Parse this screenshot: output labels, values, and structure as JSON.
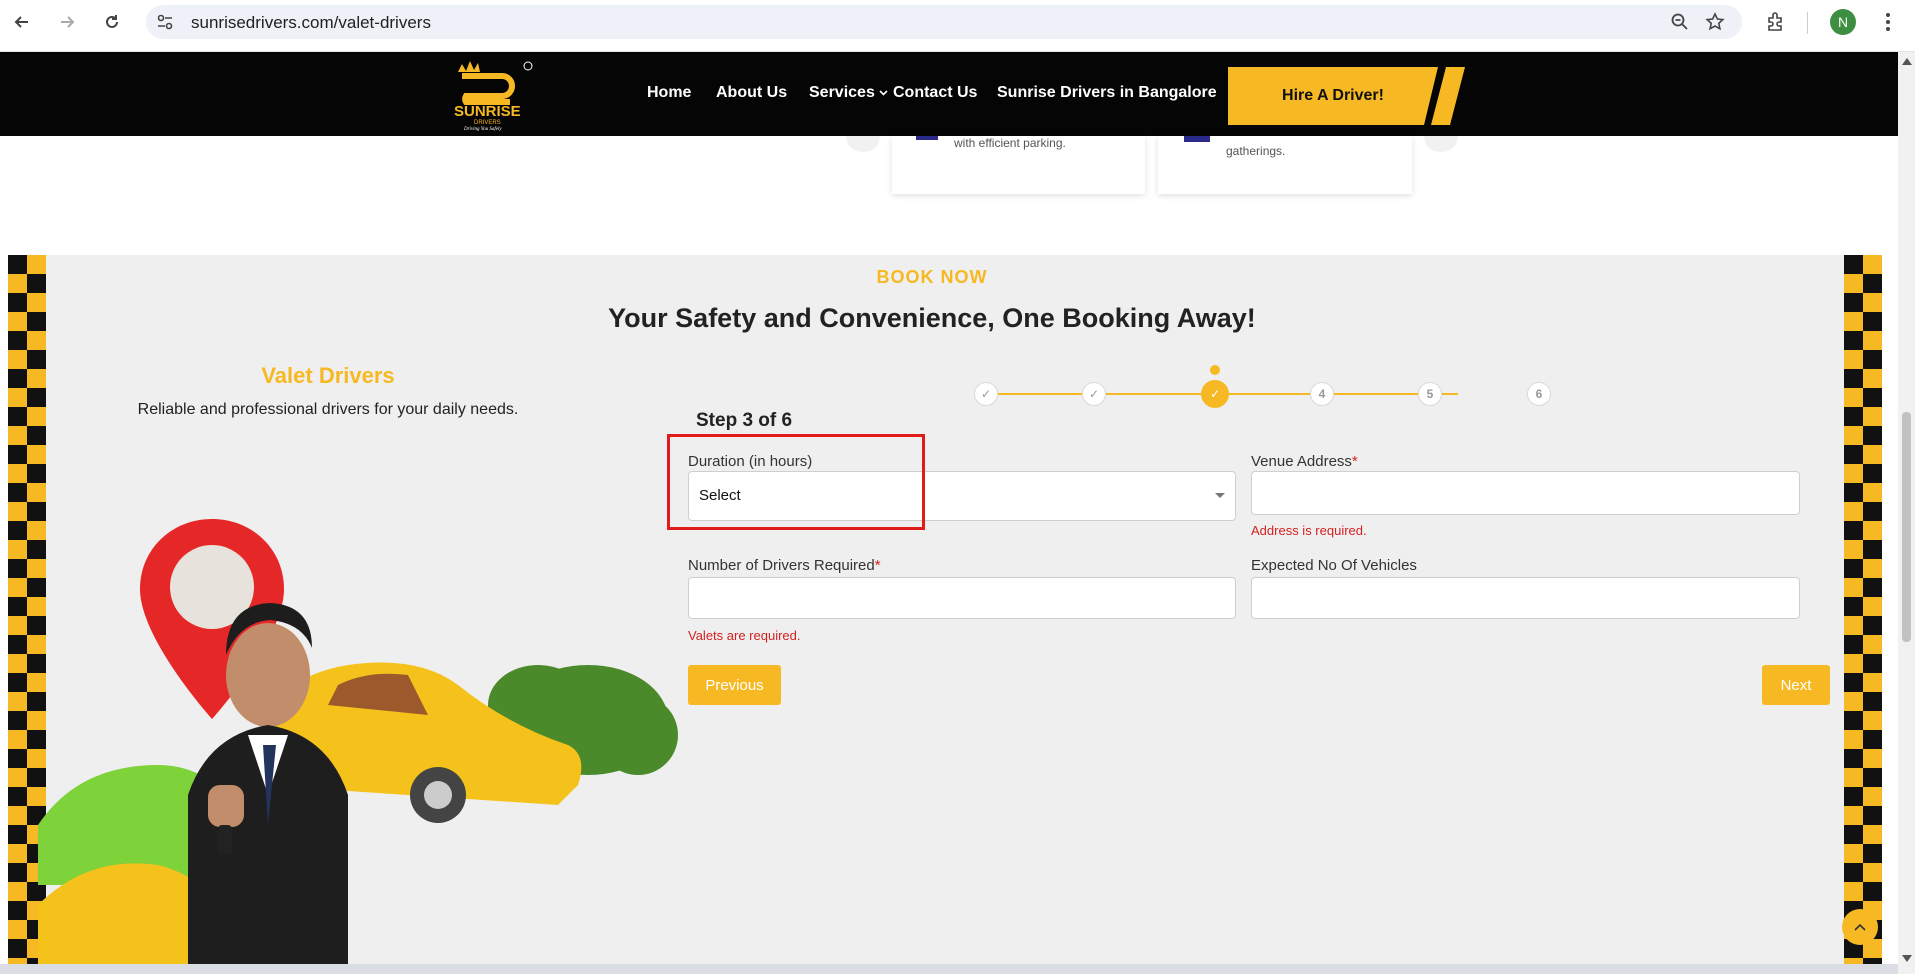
{
  "browser": {
    "url": "sunrisedrivers.com/valet-drivers",
    "profile_initial": "N"
  },
  "header": {
    "logo_text": "SUNRISE",
    "logo_sub": "DRIVERS",
    "logo_tagline": "Driving You Safely",
    "nav": {
      "home": "Home",
      "about": "About Us",
      "services": "Services",
      "contact": "Contact Us",
      "bangalore": "Sunrise Drivers in Bangalore"
    },
    "hire_label": "Hire A Driver!"
  },
  "cards": {
    "card1_text": "with efficient parking.",
    "card2_text": "gatherings."
  },
  "booking": {
    "eyebrow": "BOOK NOW",
    "headline": "Your Safety and Convenience, One Booking Away!",
    "service_title": "Valet Drivers",
    "service_subtitle": "Reliable and professional drivers for your daily needs.",
    "step_label": "Step 3 of 6",
    "steps": [
      "✓",
      "✓",
      "✓",
      "4",
      "5",
      "6"
    ],
    "current_step": 3,
    "fields": {
      "duration_label": "Duration (in hours)",
      "duration_value": "Select",
      "venue_label": "Venue Address",
      "venue_error": "Address is required.",
      "drivers_label": "Number of Drivers Required",
      "drivers_error": "Valets are required.",
      "vehicles_label": "Expected No Of Vehicles"
    },
    "previous_label": "Previous",
    "next_label": "Next"
  },
  "colors": {
    "accent": "#f7b923",
    "error": "#d32222",
    "header_bg": "#050505"
  }
}
